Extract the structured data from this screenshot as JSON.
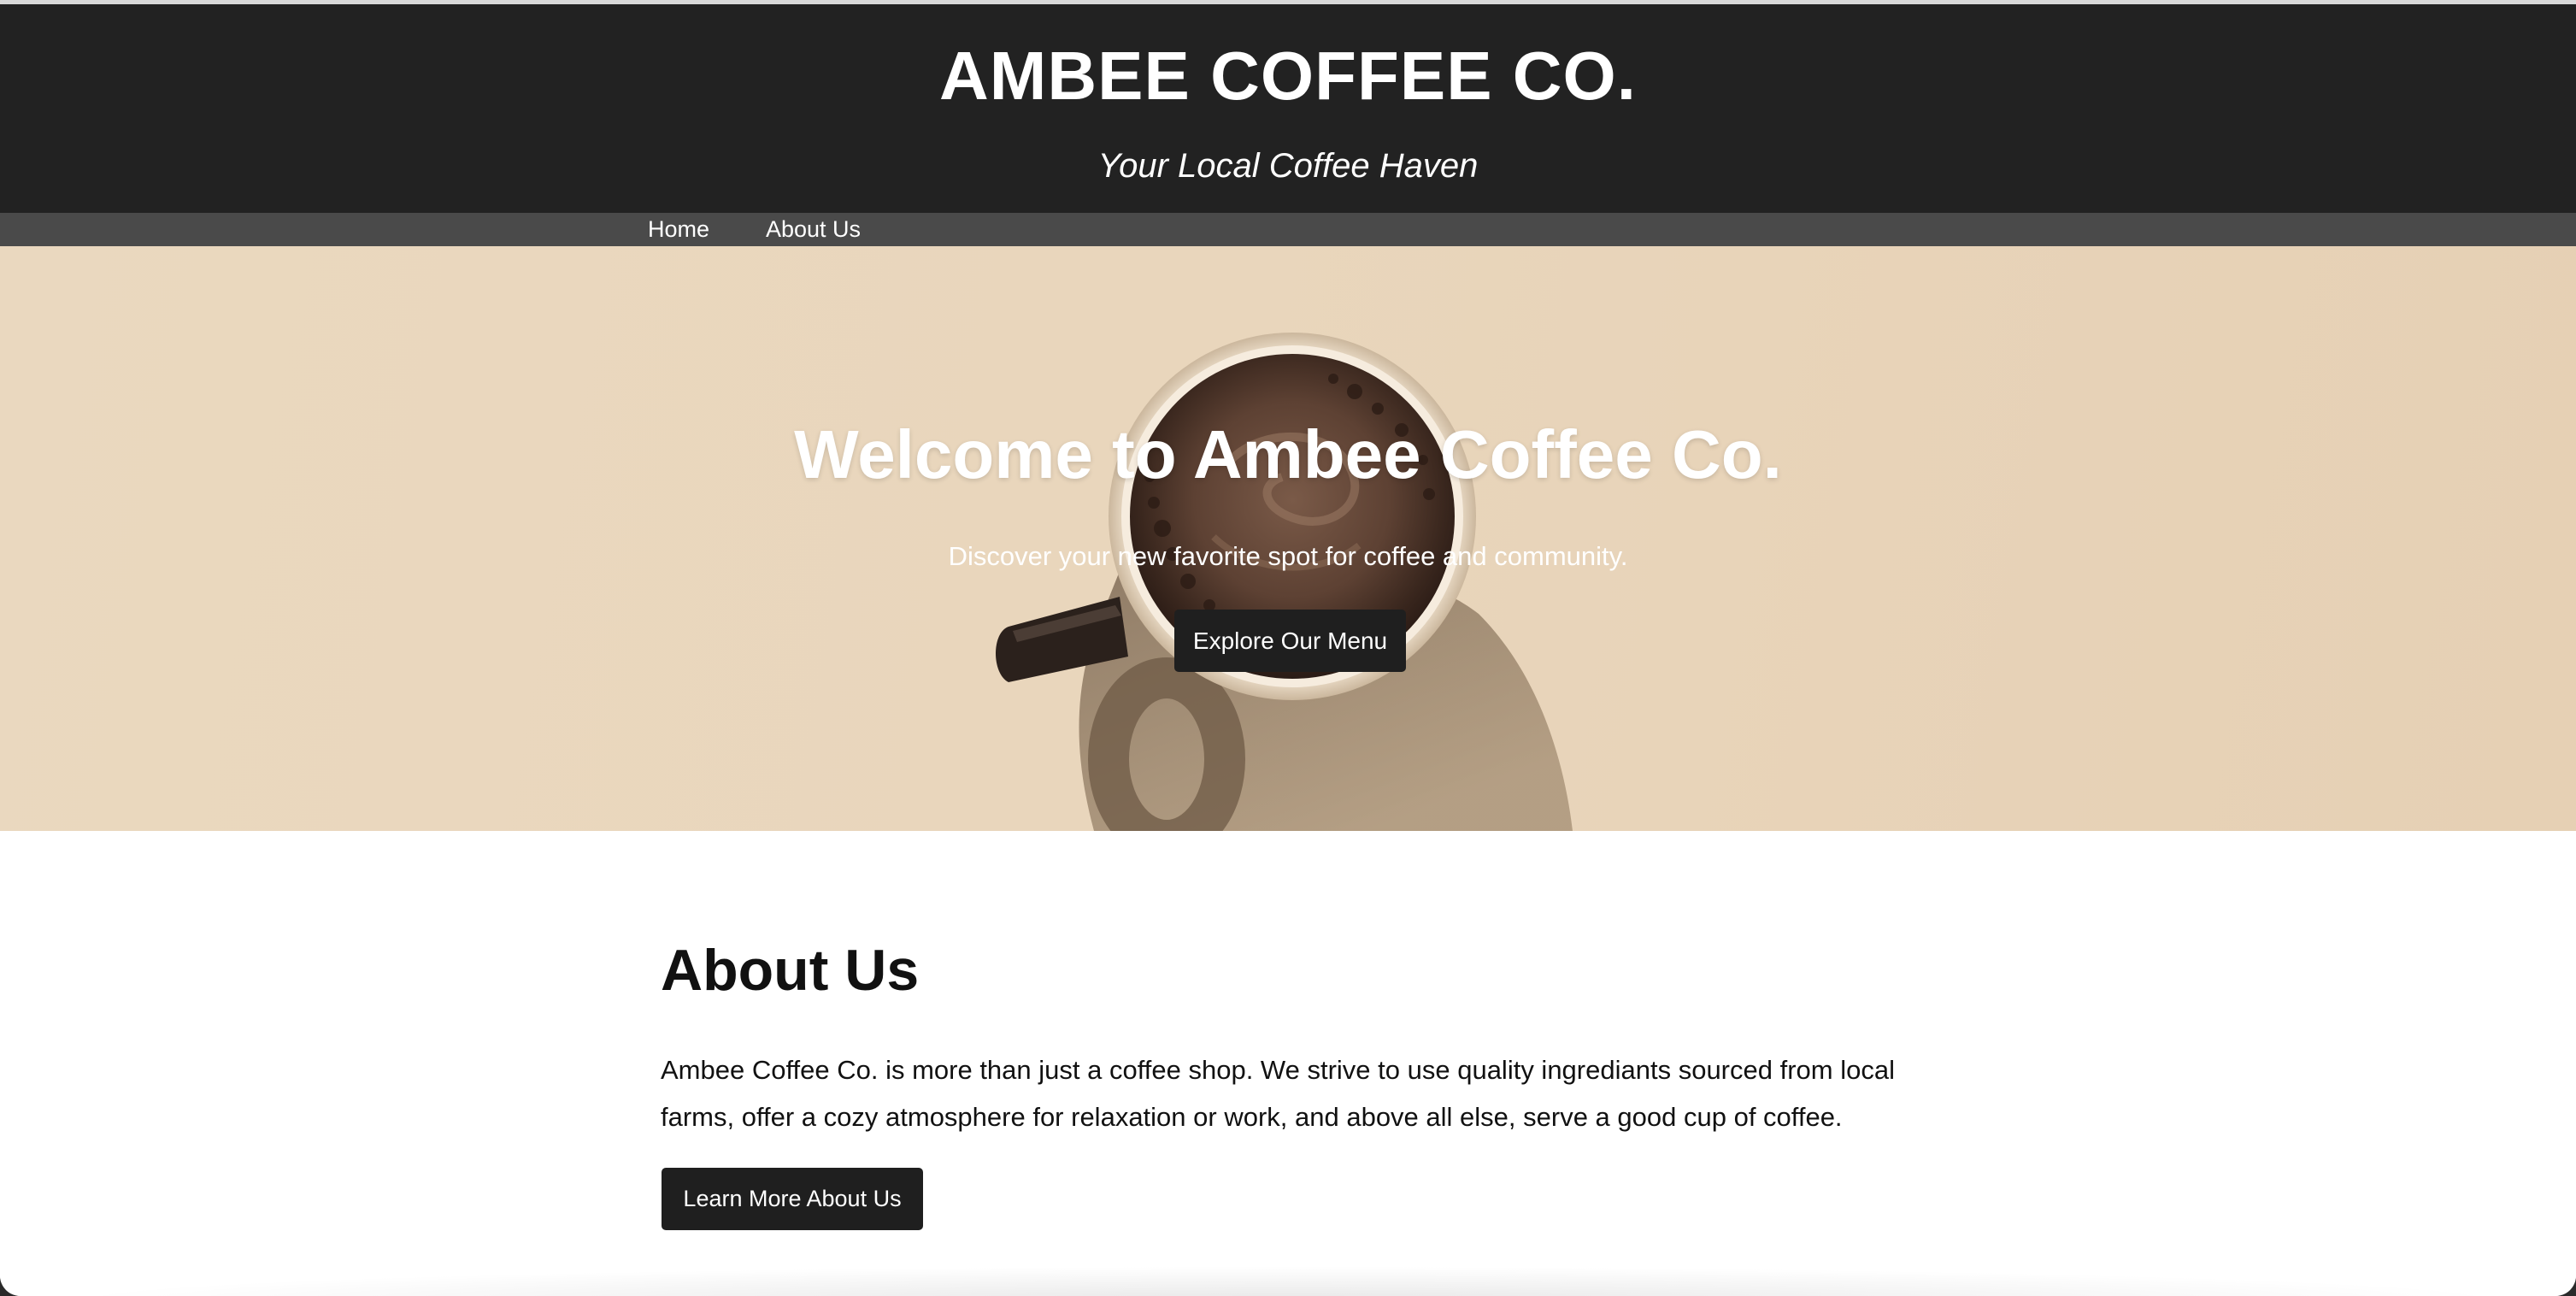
{
  "header": {
    "brand": "AMBEE COFFEE CO.",
    "tagline": "Your Local Coffee Haven"
  },
  "nav": {
    "items": [
      {
        "label": "Home"
      },
      {
        "label": "About Us"
      }
    ]
  },
  "hero": {
    "title": "Welcome to Ambee Coffee Co.",
    "subtitle": "Discover your new favorite spot for coffee and community.",
    "cta_label": "Explore Our Menu",
    "image": "coffee-cup-top-view"
  },
  "about": {
    "title": "About Us",
    "body": "Ambee Coffee Co. is more than just a coffee shop. We strive to use quality ingrediants sourced from local farms, offer a cozy atmosphere for relaxation or work, and above all else, serve a good cup of coffee.",
    "cta_label": "Learn More About Us"
  },
  "colors": {
    "header_bg": "#222222",
    "nav_bg": "#4a4a4a",
    "hero_bg": "#e9d6bc",
    "button_bg": "#1f1f1f",
    "text_light": "#ffffff",
    "text_dark": "#111111"
  }
}
